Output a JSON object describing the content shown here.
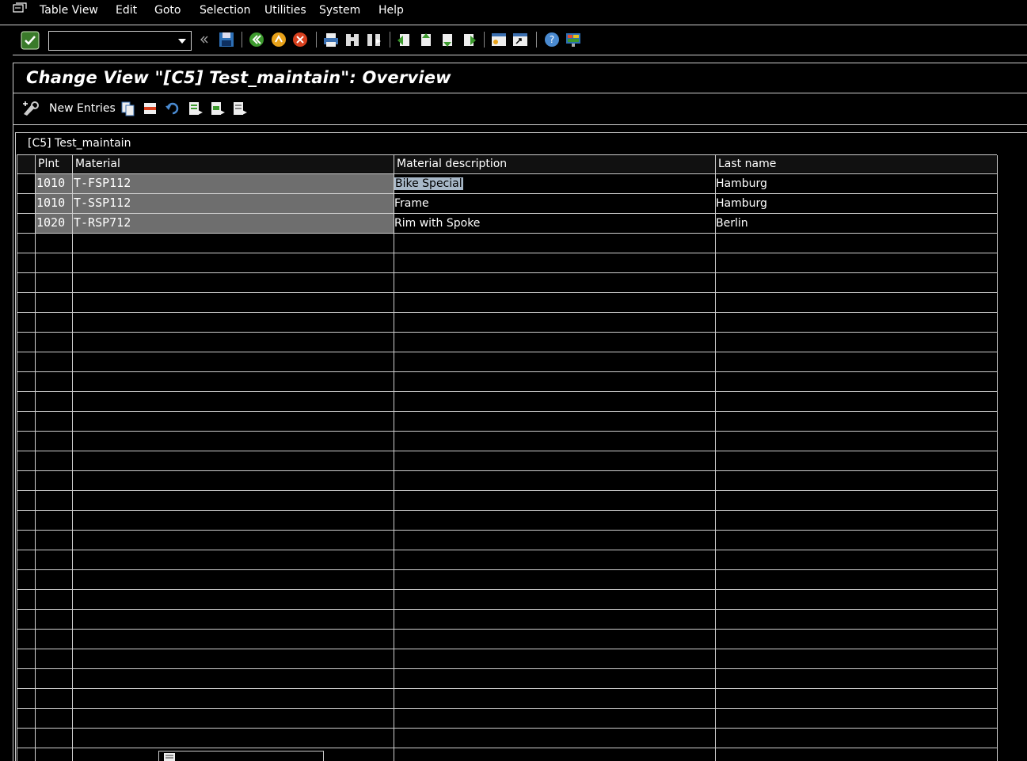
{
  "menu": {
    "items": [
      "Table View",
      "Edit",
      "Goto",
      "Selection",
      "Utilities",
      "System",
      "Help"
    ]
  },
  "title": "Change View \"[C5] Test_maintain\": Overview",
  "app_toolbar": {
    "new_entries": "New Entries"
  },
  "table": {
    "title": "[C5] Test_maintain",
    "columns": [
      "Plnt",
      "Material",
      "Material description",
      "Last name"
    ],
    "rows": [
      {
        "plant": "1010",
        "material": "T-FSP112",
        "description": "Bike Special",
        "last_name": "Hamburg"
      },
      {
        "plant": "1010",
        "material": "T-SSP112",
        "description": "Frame",
        "last_name": "Hamburg"
      },
      {
        "plant": "1020",
        "material": "T-RSP712",
        "description": "Rim with Spoke",
        "last_name": "Berlin"
      }
    ]
  },
  "icons": {
    "enter": "check-icon",
    "save": "save-icon",
    "back": "back-icon",
    "exit": "exit-icon",
    "cancel": "cancel-icon",
    "print": "print-icon",
    "find": "find-icon",
    "find_next": "find-next-icon",
    "first_page": "first-page-icon",
    "prev_page": "previous-page-icon",
    "next_page": "next-page-icon",
    "last_page": "last-page-icon",
    "new_session": "new-session-icon",
    "shortcut": "shortcut-icon",
    "help": "help-icon",
    "layout": "layout-icon"
  },
  "colors": {
    "background": "#000000",
    "selected_cell": "#6e6e6e",
    "grid": "#cfcfcf",
    "highlight": "#a8b8c8"
  }
}
